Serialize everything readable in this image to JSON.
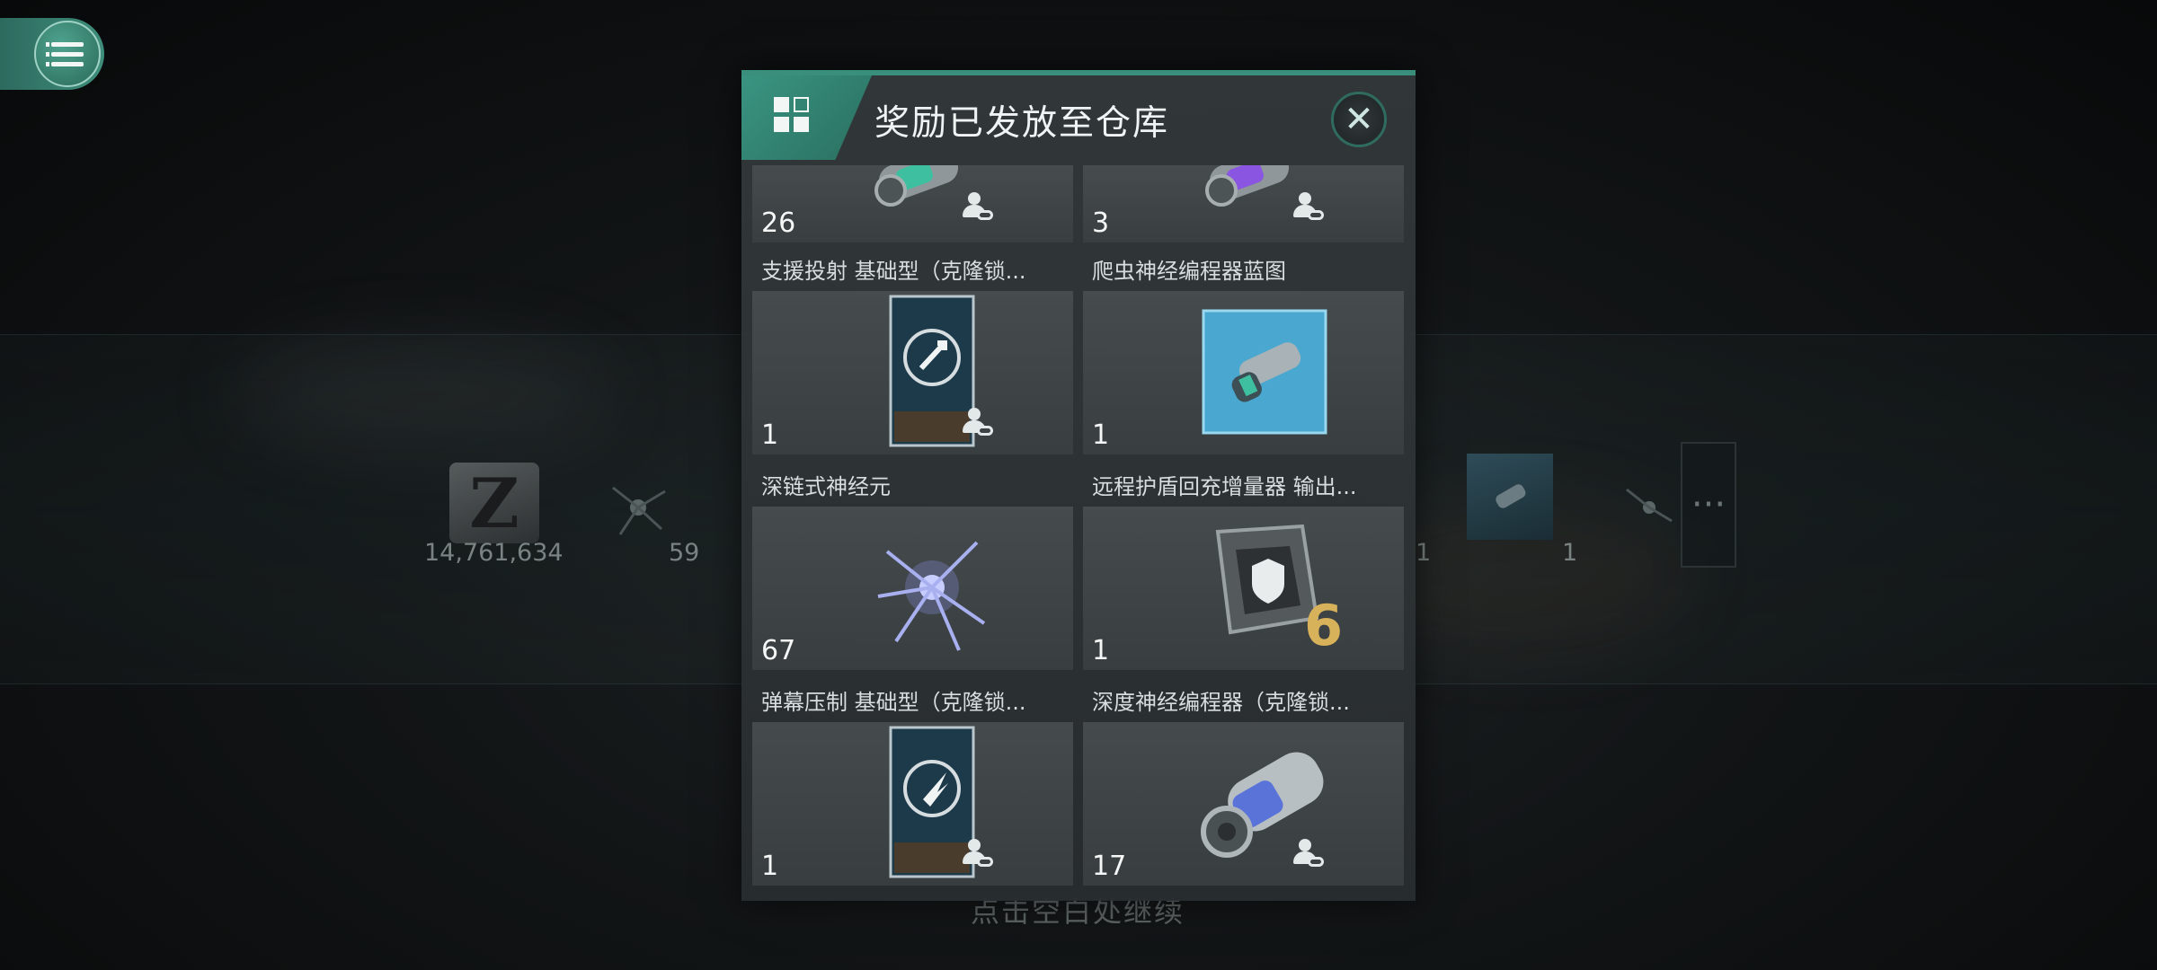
{
  "menu": {
    "icon": "menu-icon"
  },
  "modal": {
    "title": "奖励已发放至仓库",
    "header_icon": "grid-icon",
    "close_icon": "close-icon",
    "accent": "#3a8f7c"
  },
  "items": [
    {
      "label": "",
      "count": "26",
      "icon": "neural-programmer-green-icon",
      "clone_locked": true
    },
    {
      "label": "",
      "count": "3",
      "icon": "neural-programmer-purple-icon",
      "clone_locked": true
    },
    {
      "label": "支援投射 基础型（克隆锁...",
      "count": "1",
      "icon": "skill-card-support-icon",
      "clone_locked": true
    },
    {
      "label": "爬虫神经编程器蓝图",
      "count": "1",
      "icon": "blueprint-icon",
      "clone_locked": false
    },
    {
      "label": "深链式神经元",
      "count": "67",
      "icon": "neuron-icon",
      "clone_locked": false
    },
    {
      "label": "远程护盾回充增量器 输出...",
      "count": "1",
      "icon": "shield-module-icon",
      "module_level": "6",
      "clone_locked": false
    },
    {
      "label": "弹幕压制 基础型（克隆锁...",
      "count": "1",
      "icon": "skill-card-barrage-icon",
      "clone_locked": true
    },
    {
      "label": "深度神经编程器（克隆锁...",
      "count": "17",
      "icon": "deep-neural-programmer-icon",
      "clone_locked": true
    }
  ],
  "background": {
    "isk_amount": "14,761,634",
    "bg_count_2": "59",
    "bg_count_3": "1",
    "bg_count_4": "1",
    "more_label": "···",
    "hint": "点击空白处继续"
  }
}
